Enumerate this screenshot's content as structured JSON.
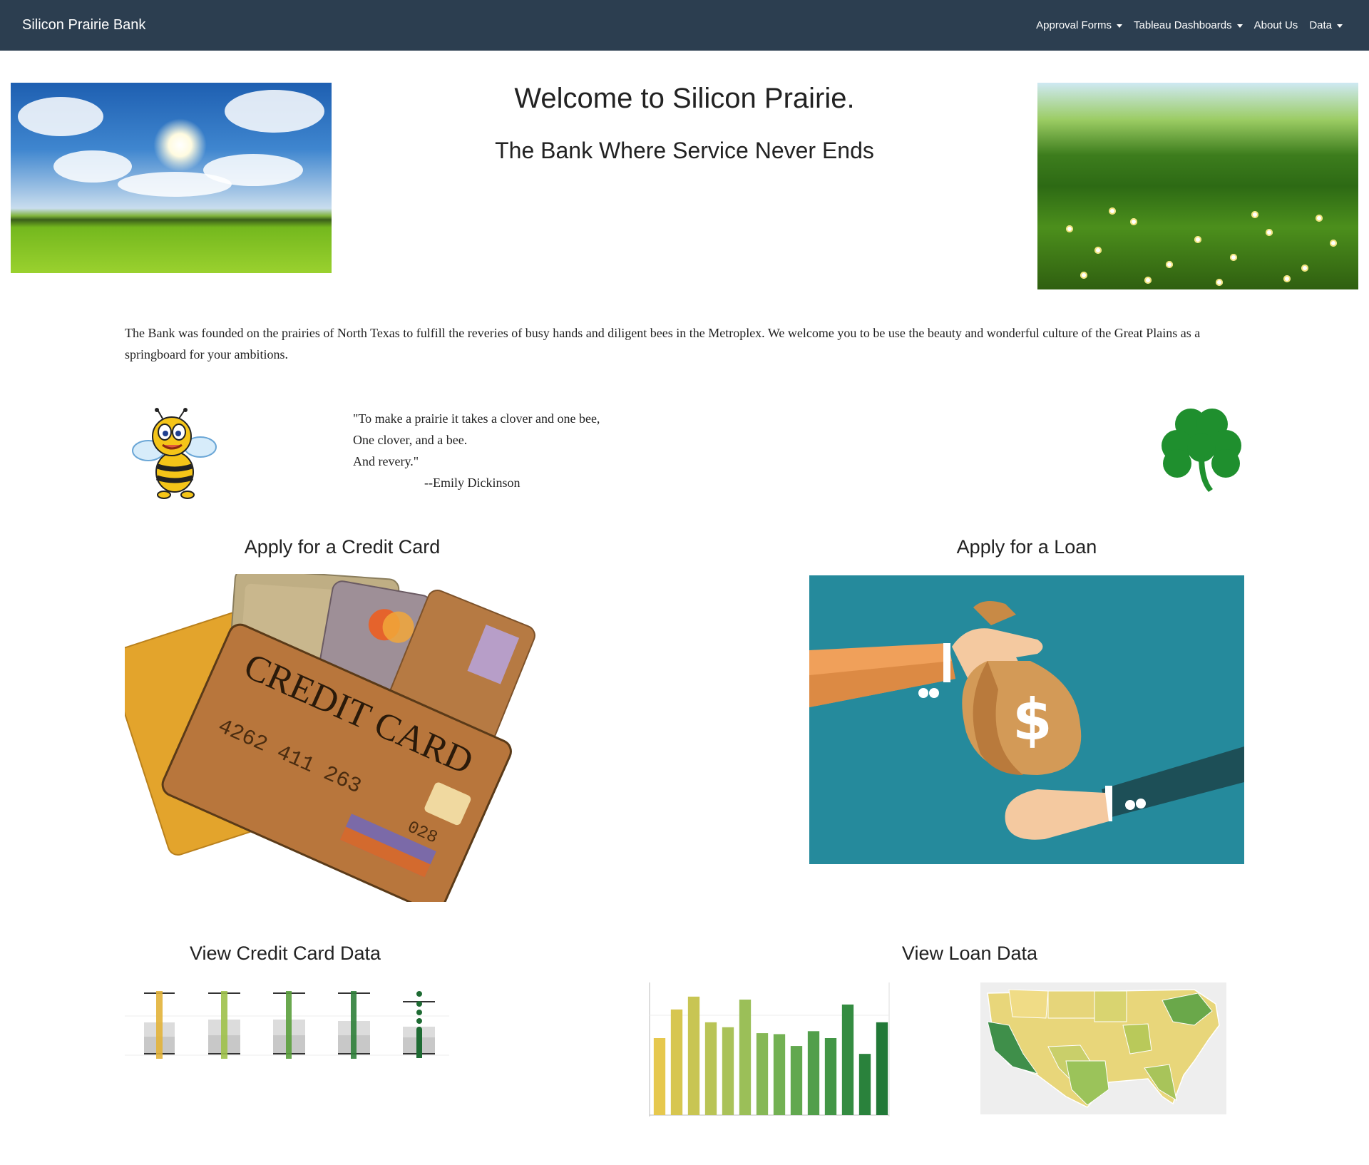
{
  "navbar": {
    "brand": "Silicon Prairie Bank",
    "items": [
      {
        "label": "Approval Forms",
        "dropdown": true
      },
      {
        "label": "Tableau Dashboards",
        "dropdown": true
      },
      {
        "label": "About Us",
        "dropdown": false
      },
      {
        "label": "Data",
        "dropdown": true
      }
    ]
  },
  "hero": {
    "title": "Welcome to Silicon Prairie.",
    "tagline": "The Bank Where Service Never Ends"
  },
  "intro": "The Bank was founded on the prairies of North Texas to fulfill the reveries of busy hands and diligent bees in the Metroplex. We welcome you to be use the beauty and wonderful culture of the Great Plains as a springboard for your ambitions.",
  "quote": {
    "line1": "\"To make a prairie it takes a clover and one bee,",
    "line2": "One clover, and a bee.",
    "line3": "And revery.\"",
    "author": "--Emily Dickinson"
  },
  "sections": {
    "credit_card": "Apply for a Credit Card",
    "loan": "Apply for a Loan",
    "credit_card_data": "View Credit Card Data",
    "loan_data": "View Loan Data"
  },
  "credit_card_image": {
    "card_text": "CREDIT CARD",
    "card_number": "4262 411 263",
    "card_code": "028"
  },
  "colors": {
    "navbar": "#2c3e50",
    "loan_bg": "#258a9c",
    "clover": "#1f8f2e"
  },
  "chart_data": [
    {
      "type": "bar",
      "values": [
        78,
        107,
        120,
        94,
        89,
        117,
        83,
        82,
        70,
        85,
        78,
        112,
        62,
        94
      ]
    }
  ]
}
